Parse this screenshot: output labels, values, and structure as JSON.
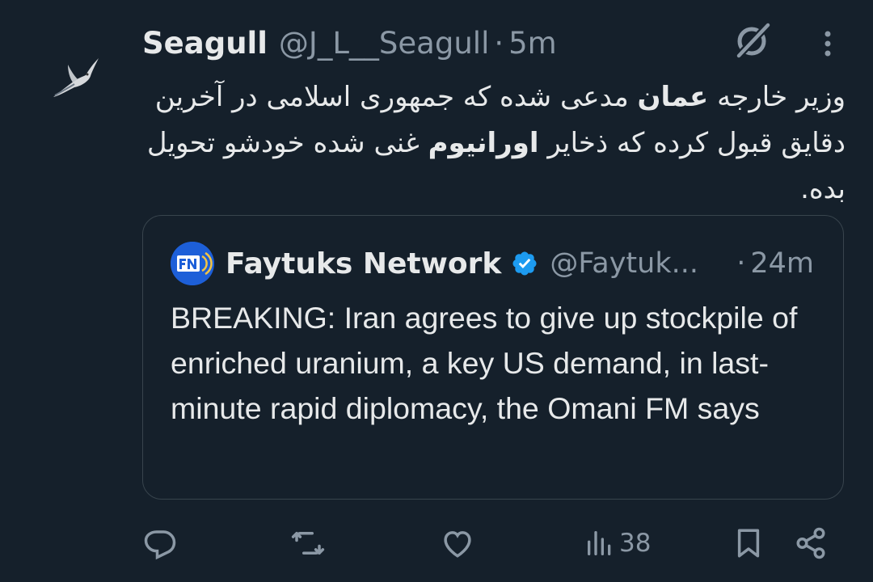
{
  "colors": {
    "background": "#15202b",
    "text_primary": "#e7e9ea",
    "text_secondary": "#8b98a5",
    "border": "#38444d",
    "verified_blue": "#1d9bf0",
    "quote_avatar_bg": "#1d5fd8"
  },
  "tweet": {
    "author": {
      "display_name": "Seagull",
      "handle": "@J_L__Seagull",
      "avatar_icon": "seagull-icon"
    },
    "separator": "·",
    "time": "5m",
    "text": {
      "seg1": "وزیر خارجه ",
      "bold1": "عمان",
      "seg2": " مدعی شده که جمهوری اسلامی در آخرین دقایق قبول کرده که ذخایر ",
      "bold2": "اورانیوم",
      "seg3": " غنی شده خودشو تحویل بده."
    },
    "icons": {
      "grok": "grok-icon",
      "more": "more-vertical-icon"
    }
  },
  "quote": {
    "author": {
      "display_name": "Faytuks Network",
      "handle": "@Faytuk...",
      "verified": true,
      "avatar_label": "FN"
    },
    "separator": "·",
    "time": "24m",
    "text": "BREAKING: Iran agrees to give up stockpile of enriched uranium, a key US demand, in last-minute rapid diplomacy, the Omani FM says"
  },
  "actions": {
    "reply_icon": "reply-icon",
    "retweet_icon": "retweet-icon",
    "like_icon": "like-icon",
    "views_icon": "views-icon",
    "views_count": "38",
    "bookmark_icon": "bookmark-icon",
    "share_icon": "share-icon"
  }
}
